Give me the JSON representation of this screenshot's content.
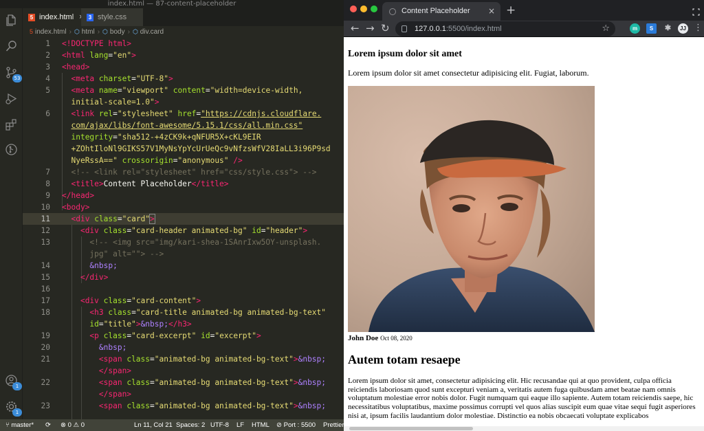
{
  "vscode": {
    "window_title": "index.html — 87-content-placeholder",
    "tabs": [
      {
        "label": "index.html",
        "close": "×"
      },
      {
        "label": "style.css"
      }
    ],
    "breadcrumb": [
      "index.html",
      "html",
      "body",
      "div.card"
    ],
    "activity_badges": {
      "source_control": "53",
      "accounts": "1",
      "manage": "1"
    },
    "status": {
      "branch": "master*",
      "problems": "0",
      "warnings": "0",
      "cursor": "Ln 11, Col 21",
      "spaces": "Spaces: 2",
      "encoding": "UTF-8",
      "eol": "LF",
      "language": "HTML",
      "port": "Port : 5500",
      "prettier": "Prettier"
    },
    "line_numbers": {
      "l1": "1",
      "l2": "2",
      "l3": "3",
      "l4": "4",
      "l5": "5",
      "l6": "6",
      "l7": "7",
      "l8": "8",
      "l9": "9",
      "l10": "10",
      "l11": "11",
      "l12": "12",
      "l13": "13",
      "l14": "14",
      "l15": "15",
      "l16": "16",
      "l17": "17",
      "l18": "18",
      "l19": "19",
      "l20": "20",
      "l21": "21",
      "l22": "22",
      "l23": "23"
    },
    "code": {
      "doctype": "<!DOCTYPE html>",
      "html_open_tag": "<html",
      "html_lang_attr": "lang",
      "html_lang_val": "\"en\"",
      "head_open": "<head>",
      "meta": "<meta",
      "charset_attr": "charset",
      "charset_val": "\"UTF-8\"",
      "name_attr": "name",
      "viewport_val": "\"viewport\"",
      "content_attr": "content",
      "content_val_1": "\"width=device-width,",
      "content_val_2": "initial-scale=1.0\"",
      "link": "<link",
      "rel_attr": "rel",
      "stylesheet_val": "\"stylesheet\"",
      "href_attr": "href",
      "href_val_1": "\"https://cdnjs.cloudflare.",
      "href_val_2": "com/ajax/libs/font-awesome/5.15.1/css/all.min.css\"",
      "integrity_attr": "integrity",
      "integrity_val_1": "\"sha512-+4zCK9k+qNFUR5X+cKL9EIR",
      "integrity_val_2": "+ZOhtIloNl9GIKS57V1MyNsYpYcUrUeQc9vNfzsWfV28IaLL3i96P9sd",
      "integrity_val_3": "NyeRssA==\"",
      "crossorigin_attr": "crossorigin",
      "crossorigin_val": "\"anonymous\"",
      "selfclose": "/>",
      "comment_link": "<!-- <link rel=\"stylesheet\" href=\"css/style.css\"> -->",
      "title_open": "<title>",
      "title_text": "Content Placeholder",
      "title_close": "</title>",
      "head_close": "</head>",
      "body_open": "<body>",
      "div_open": "<div",
      "class_attr": "class",
      "card_val": "\"card\"",
      "card_header_val": "\"card-header animated-bg\"",
      "id_attr": "id",
      "header_val": "\"header\"",
      "comment_img_1": "<!-- <img src=\"img/kari-shea-1SAnrIxw5OY-unsplash.",
      "comment_img_2": "jpg\" alt=\"\"> -->",
      "nbsp": "&nbsp;",
      "div_close": "</div>",
      "card_content_val": "\"card-content\"",
      "h3_open": "<h3",
      "card_title_val": "\"card-title animated-bg animated-bg-text\"",
      "title_id_val": "\"title\"",
      "h3_close": "</h3>",
      "p_open": "<p",
      "card_excerpt_val": "\"card-excerpt\"",
      "excerpt_val": "\"excerpt\"",
      "span_open": "<span",
      "animated_text_val": "\"animated-bg animated-bg-text\"",
      "span_close": "</span>",
      "gt": ">"
    }
  },
  "browser": {
    "tab_title": "Content Placeholder",
    "tab_close": "×",
    "new_tab": "+",
    "url_host": "127.0.0.1",
    "url_rest": ":5500/index.html",
    "extensions": [
      "m",
      "S",
      "✱",
      "JJ"
    ],
    "page": {
      "heading": "Lorem ipsum dolor sit amet",
      "intro": "Lorem ipsum dolor sit amet consectetur adipisicing elit. Fugiat, laborum.",
      "author": "John Doe",
      "date": "Oct 08, 2020",
      "title": "Autem totam resaepe",
      "body": "Lorem ipsum dolor sit amet, consectetur adipisicing elit. Hic recusandae qui at quo provident, culpa officia reiciendis laboriosam quod sunt excepturi veniam a, veritatis autem fuga quibusdam amet beatae nam omnis voluptatum molestiae error nobis dolor. Fugit numquam qui eaque illo sapiente. Autem totam reiciendis saepe, hic necessitatibus voluptatibus, maxime possimus corrupti vel quos alias suscipit eum quae vitae sequi fugit asperiores nisi at, ipsum facilis laudantium dolor molestiae. Distinctio ea nobis obcaecati voluptate explicabos"
    }
  },
  "colors": {
    "editor_bg": "#272822",
    "status_bg": "#414339",
    "tag": "#f92672",
    "attr": "#a6e22e",
    "string": "#e6db74",
    "comment": "#75715e",
    "entity": "#ae81ff",
    "chrome_dark": "#202124"
  }
}
